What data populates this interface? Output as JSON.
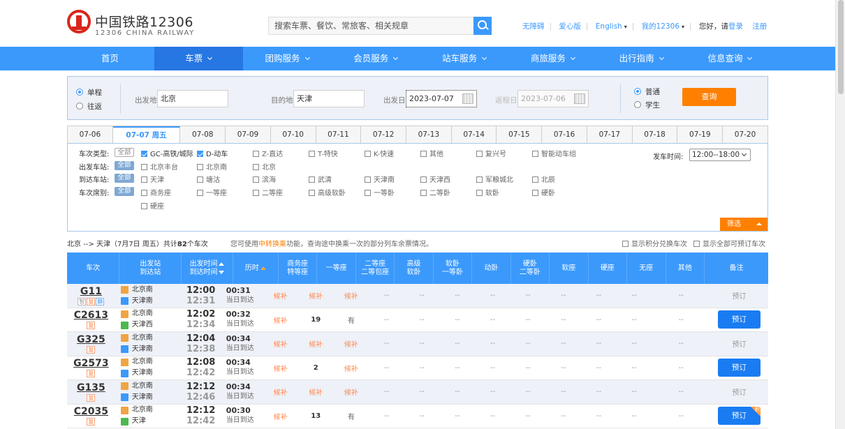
{
  "header": {
    "logo_cn": "中国铁路12306",
    "logo_en": "12306 CHINA RAILWAY",
    "search_placeholder": "搜索车票、餐饮、常旅客、相关规章",
    "links": [
      "无障碍",
      "爱心版",
      "English",
      "我的12306"
    ],
    "greeting": "您好，请",
    "login": "登录",
    "register": "注册"
  },
  "nav": [
    {
      "label": "首页",
      "dropdown": false
    },
    {
      "label": "车票",
      "dropdown": true,
      "active": true
    },
    {
      "label": "团购服务",
      "dropdown": true
    },
    {
      "label": "会员服务",
      "dropdown": true
    },
    {
      "label": "站车服务",
      "dropdown": true
    },
    {
      "label": "商旅服务",
      "dropdown": true
    },
    {
      "label": "出行指南",
      "dropdown": true
    },
    {
      "label": "信息查询",
      "dropdown": true
    }
  ],
  "query": {
    "trip_oneway": "单程",
    "trip_round": "往返",
    "from_label": "出发地",
    "from_value": "北京",
    "to_label": "目的地",
    "to_value": "天津",
    "date_label": "出发日",
    "date_value": "2023-07-07",
    "return_label": "返程日",
    "return_value": "2023-07-06",
    "type_normal": "普通",
    "type_student": "学生",
    "submit": "查询"
  },
  "dates": [
    "07-06",
    "07-07 周五",
    "07-08",
    "07-09",
    "07-10",
    "07-11",
    "07-12",
    "07-13",
    "07-14",
    "07-15",
    "07-16",
    "07-17",
    "07-18",
    "07-19",
    "07-20"
  ],
  "active_date_index": 1,
  "filter": {
    "all": "全部",
    "type_label": "车次类型:",
    "types": [
      "GC-高铁/城际",
      "D-动车",
      "Z-直达",
      "T-特快",
      "K-快速",
      "其他",
      "复兴号",
      "智能动车组"
    ],
    "from_label": "出发车站:",
    "from_stations": [
      "北京丰台",
      "北京南",
      "北京"
    ],
    "to_label": "到达车站:",
    "to_stations": [
      "天津",
      "塘沽",
      "滨海",
      "武清",
      "天津南",
      "天津西",
      "军粮城北",
      "北辰"
    ],
    "seat_label": "车次席别:",
    "seats": [
      "商务座",
      "一等座",
      "二等座",
      "高级软卧",
      "一等卧",
      "二等卧",
      "软卧",
      "硬卧",
      "硬座"
    ],
    "time_label": "发车时间:",
    "time_value": "12:00--18:00",
    "screen": "筛选"
  },
  "summary": {
    "route": "北京 --> 天津（7月7日  周五）共计",
    "count": "82",
    "unit": "个车次",
    "hint_pre": "您可使用",
    "hint_hl": "中转换乘",
    "hint_post": "功能，查询途中换乘一次的部分列车余票情况。",
    "opt_points": "显示积分兑换车次",
    "opt_all": "显示全部可预订车次"
  },
  "columns": [
    {
      "l1": "车次",
      "l2": ""
    },
    {
      "l1": "出发站",
      "l2": "到达站"
    },
    {
      "l1": "出发时间",
      "l2": "到达时间"
    },
    {
      "l1": "历时",
      "l2": ""
    },
    {
      "l1": "商务座",
      "l2": "特等座"
    },
    {
      "l1": "一等座",
      "l2": ""
    },
    {
      "l1": "二等座",
      "l2": "二等包座"
    },
    {
      "l1": "高级",
      "l2": "软卧"
    },
    {
      "l1": "软卧",
      "l2": "一等卧"
    },
    {
      "l1": "动卧",
      "l2": ""
    },
    {
      "l1": "硬卧",
      "l2": "二等卧"
    },
    {
      "l1": "软座",
      "l2": ""
    },
    {
      "l1": "硬座",
      "l2": ""
    },
    {
      "l1": "无座",
      "l2": ""
    },
    {
      "l1": "其他",
      "l2": ""
    },
    {
      "l1": "备注",
      "l2": ""
    }
  ],
  "trains": [
    {
      "no": "G11",
      "badges": [
        "智",
        "复",
        "静"
      ],
      "from": "北京南",
      "to": "天津南",
      "dep": "12:00",
      "arr": "12:31",
      "dur": "00:31",
      "day": "当日到达",
      "seats": [
        "候补",
        "候补",
        "候补",
        "--",
        "--",
        "--",
        "--",
        "--",
        "--",
        "--",
        "--",
        "--"
      ],
      "book": "预订",
      "bookable": false
    },
    {
      "no": "C2613",
      "badges": [
        "复"
      ],
      "from": "北京南",
      "to": "天津西",
      "dep": "12:02",
      "arr": "12:34",
      "dur": "00:32",
      "day": "当日到达",
      "seats": [
        "候补",
        "19",
        "有",
        "--",
        "--",
        "--",
        "--",
        "--",
        "--",
        "--",
        "--",
        "--"
      ],
      "book": "预订",
      "bookable": true
    },
    {
      "no": "G325",
      "badges": [
        "复"
      ],
      "from": "北京南",
      "to": "天津南",
      "dep": "12:04",
      "arr": "12:38",
      "dur": "00:34",
      "day": "当日到达",
      "seats": [
        "候补",
        "候补",
        "候补",
        "--",
        "--",
        "--",
        "--",
        "--",
        "--",
        "--",
        "--",
        "--"
      ],
      "book": "预订",
      "bookable": false
    },
    {
      "no": "G2573",
      "badges": [
        "复"
      ],
      "from": "北京南",
      "to": "天津南",
      "dep": "12:08",
      "arr": "12:42",
      "dur": "00:34",
      "day": "当日到达",
      "seats": [
        "候补",
        "2",
        "候补",
        "--",
        "--",
        "--",
        "--",
        "--",
        "--",
        "--",
        "--",
        "--"
      ],
      "book": "预订",
      "bookable": true
    },
    {
      "no": "G135",
      "badges": [
        "复"
      ],
      "from": "北京南",
      "to": "天津南",
      "dep": "12:12",
      "arr": "12:46",
      "dur": "00:34",
      "day": "当日到达",
      "seats": [
        "候补",
        "候补",
        "候补",
        "--",
        "--",
        "--",
        "--",
        "--",
        "--",
        "--",
        "--",
        "--"
      ],
      "book": "预订",
      "bookable": false
    },
    {
      "no": "C2035",
      "badges": [
        "复"
      ],
      "from": "北京南",
      "to": "天津",
      "dep": "12:12",
      "arr": "12:42",
      "dur": "00:30",
      "day": "当日到达",
      "seats": [
        "候补",
        "13",
        "有",
        "--",
        "--",
        "--",
        "--",
        "--",
        "--",
        "--",
        "--",
        "--"
      ],
      "book": "预订",
      "bookable": true,
      "corner": "积"
    }
  ],
  "colors": {
    "primary": "#3b99fc",
    "accent": "#ff8000",
    "waitlist": "#ff8a50"
  }
}
